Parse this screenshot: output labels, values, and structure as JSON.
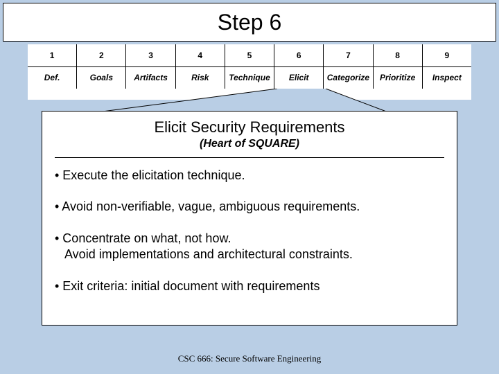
{
  "title": "Step 6",
  "steps": [
    {
      "num": "1",
      "label": "Def."
    },
    {
      "num": "2",
      "label": "Goals"
    },
    {
      "num": "3",
      "label": "Artifacts"
    },
    {
      "num": "4",
      "label": "Risk"
    },
    {
      "num": "5",
      "label": "Technique"
    },
    {
      "num": "6",
      "label": "Elicit"
    },
    {
      "num": "7",
      "label": "Categorize"
    },
    {
      "num": "8",
      "label": "Prioritize"
    },
    {
      "num": "9",
      "label": "Inspect"
    }
  ],
  "section": {
    "heading": "Elicit Security Requirements",
    "subtitle": "(Heart of SQUARE)",
    "bullets": [
      "• Execute the elicitation technique.",
      "• Avoid non-verifiable, vague, ambiguous requirements.",
      "• Concentrate on what, not how.",
      "• Exit criteria: initial document with requirements"
    ],
    "bullet2_line2": "Avoid implementations and architectural constraints."
  },
  "footer": "CSC 666: Secure Software Engineering"
}
